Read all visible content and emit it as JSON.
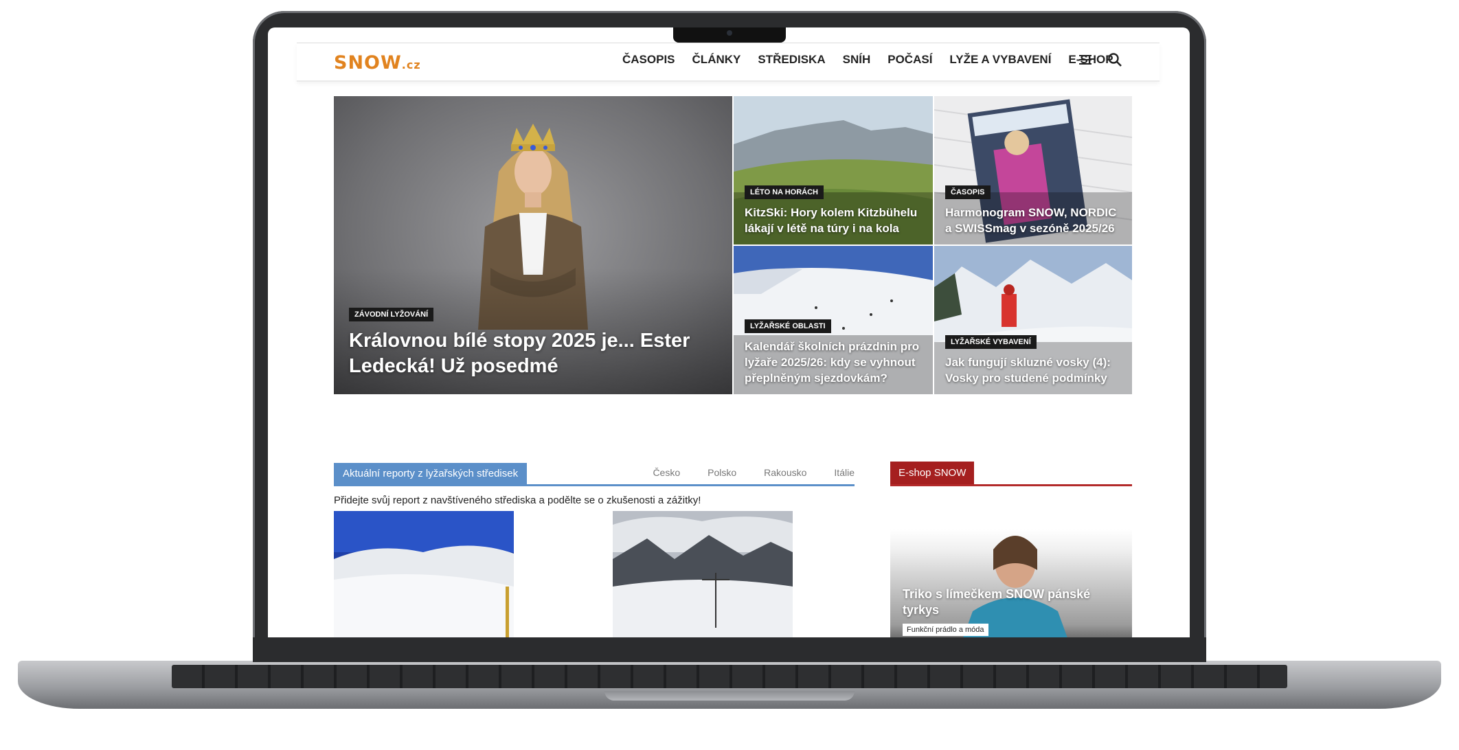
{
  "site": {
    "logo_text": "SNOW",
    "logo_tld": ".cz",
    "brand_color": "#e1831f"
  },
  "nav": {
    "items": [
      "ČASOPIS",
      "ČLÁNKY",
      "STŘEDISKA",
      "SNÍH",
      "POČASÍ",
      "LYŽE A VYBAVENÍ",
      "E-SHOP"
    ],
    "menu_icon": "hamburger-icon",
    "search_icon": "search-icon"
  },
  "hero": {
    "main": {
      "tag": "ZÁVODNÍ LYŽOVÁNÍ",
      "title": "Královnou bílé stopy 2025 je... Ester Ledecká! Už posedmé"
    },
    "tiles": [
      {
        "tag": "LÉTO NA HORÁCH",
        "title": "KitzSki: Hory kolem Kitzbühelu lákají v létě na túry i na kola"
      },
      {
        "tag": "ČASOPIS",
        "title": "Harmonogram SNOW, NORDIC a SWISSmag v sezóně 2025/26"
      },
      {
        "tag": "LYŽAŘSKÉ OBLASTI",
        "title": "Kalendář školních prázdnin pro lyžaře 2025/26: kdy se vyhnout přeplněným sjezdovkám?"
      },
      {
        "tag": "LYŽAŘSKÉ VYBAVENÍ",
        "title": "Jak fungují skluzné vosky (4): Vosky pro studené podmínky"
      }
    ]
  },
  "reports": {
    "label": "Aktuální reporty z lyžařských středisek",
    "tabs": [
      "Česko",
      "Polsko",
      "Rakousko",
      "Itálie"
    ],
    "note": "Přidejte svůj report z navštíveného střediska a podělte se o zkušenosti a zážitky!",
    "accent": "#5b8fc9"
  },
  "eshop": {
    "label": "E-shop SNOW",
    "accent": "#a51f1f",
    "product": {
      "title": "Triko s límečkem SNOW pánské tyrkys",
      "category": "Funkční prádlo a móda"
    }
  }
}
